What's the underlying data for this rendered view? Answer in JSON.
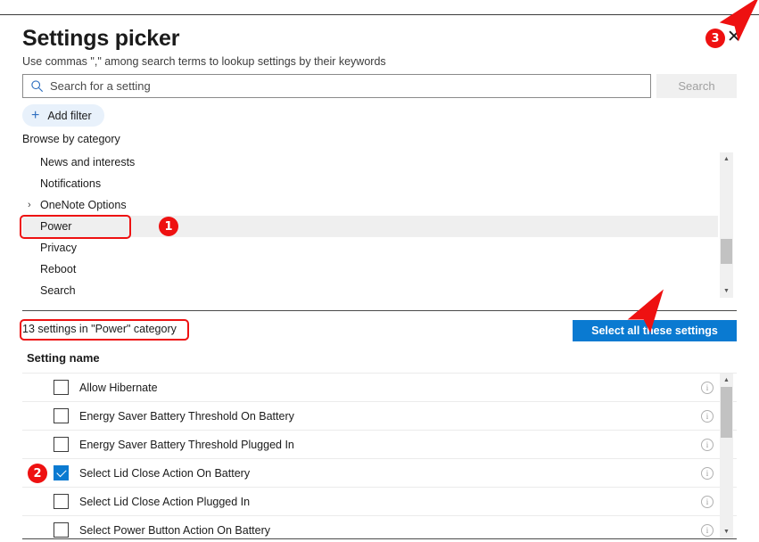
{
  "dialog": {
    "title": "Settings picker",
    "subtitle": "Use commas \",\" among search terms to lookup settings by their keywords",
    "close_label": "✕"
  },
  "search": {
    "placeholder": "Search for a setting",
    "value": "",
    "button_label": "Search",
    "icon": "search-icon"
  },
  "filter": {
    "add_label": "Add filter",
    "plus_icon": "plus-icon"
  },
  "categories": {
    "section_label": "Browse by category",
    "items": [
      {
        "label": "News and interests",
        "expandable": false,
        "selected": false
      },
      {
        "label": "Notifications",
        "expandable": false,
        "selected": false
      },
      {
        "label": "OneNote Options",
        "expandable": true,
        "selected": false
      },
      {
        "label": "Power",
        "expandable": false,
        "selected": true
      },
      {
        "label": "Privacy",
        "expandable": false,
        "selected": false
      },
      {
        "label": "Reboot",
        "expandable": false,
        "selected": false
      },
      {
        "label": "Search",
        "expandable": false,
        "selected": false
      }
    ],
    "chevron_glyph": "›"
  },
  "results": {
    "count_text": "13 settings in \"Power\" category",
    "select_all_label": "Select all these settings",
    "column_header": "Setting name",
    "rows": [
      {
        "name": "Allow Hibernate",
        "checked": false
      },
      {
        "name": "Energy Saver Battery Threshold On Battery",
        "checked": false
      },
      {
        "name": "Energy Saver Battery Threshold Plugged In",
        "checked": false
      },
      {
        "name": "Select Lid Close Action On Battery",
        "checked": true
      },
      {
        "name": "Select Lid Close Action Plugged In",
        "checked": false
      },
      {
        "name": "Select Power Button Action On Battery",
        "checked": false
      }
    ],
    "info_glyph": "i"
  },
  "scrollbars": {
    "up_glyph": "▲",
    "down_glyph": "▼"
  },
  "annotations": {
    "badges": [
      {
        "id": "1",
        "label": "1"
      },
      {
        "id": "2",
        "label": "2"
      },
      {
        "id": "3",
        "label": "3"
      }
    ],
    "accent_color": "#ee1111"
  },
  "colors": {
    "accent_blue": "#0a7ad1",
    "chip_blue": "#e8f1fb",
    "selected_row": "#efefef",
    "annotation_red": "#ee1111"
  }
}
